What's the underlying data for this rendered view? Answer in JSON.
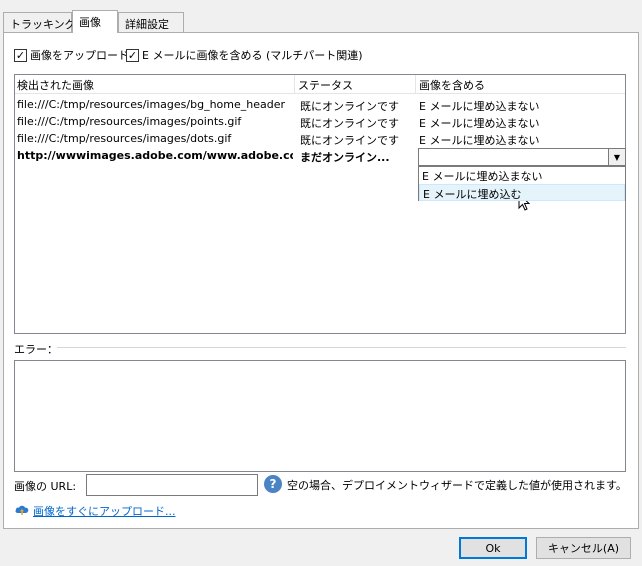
{
  "tabs": [
    {
      "label": "トラッキング"
    },
    {
      "label": "画像"
    },
    {
      "label": "詳細設定"
    }
  ],
  "options": {
    "upload_images": {
      "label": "画像をアップロード",
      "checked": true
    },
    "include_images": {
      "label": "E メールに画像を含める (マルチパート関連)",
      "checked": true
    }
  },
  "grid": {
    "columns": [
      "検出された画像",
      "ステータス",
      "画像を含める"
    ],
    "rows": [
      {
        "image": "file:///C:/tmp/resources/images/bg_home_header",
        "status": "既にオンラインです",
        "include": "E メールに埋め込まない"
      },
      {
        "image": "file:///C:/tmp/resources/images/points.gif",
        "status": "既にオンラインです",
        "include": "E メールに埋め込まない"
      },
      {
        "image": "file:///C:/tmp/resources/images/dots.gif",
        "status": "既にオンラインです",
        "include": "E メールに埋め込まない"
      },
      {
        "image": "http://wwwimages.adobe.com/www.adobe.com...",
        "status": "まだオンライン...",
        "include": ""
      }
    ],
    "dropdown_options": [
      "E メールに埋め込まない",
      "E メールに埋め込む"
    ]
  },
  "errors": {
    "label": "エラー："
  },
  "image_url": {
    "label": "画像の URL:",
    "value": "",
    "help_text": "空の場合、デプロイメントウィザードで定義した値が使用されます。"
  },
  "upload_now_link": "画像をすぐにアップロード...",
  "buttons": {
    "ok": "Ok",
    "cancel": "キャンセル(A)"
  }
}
